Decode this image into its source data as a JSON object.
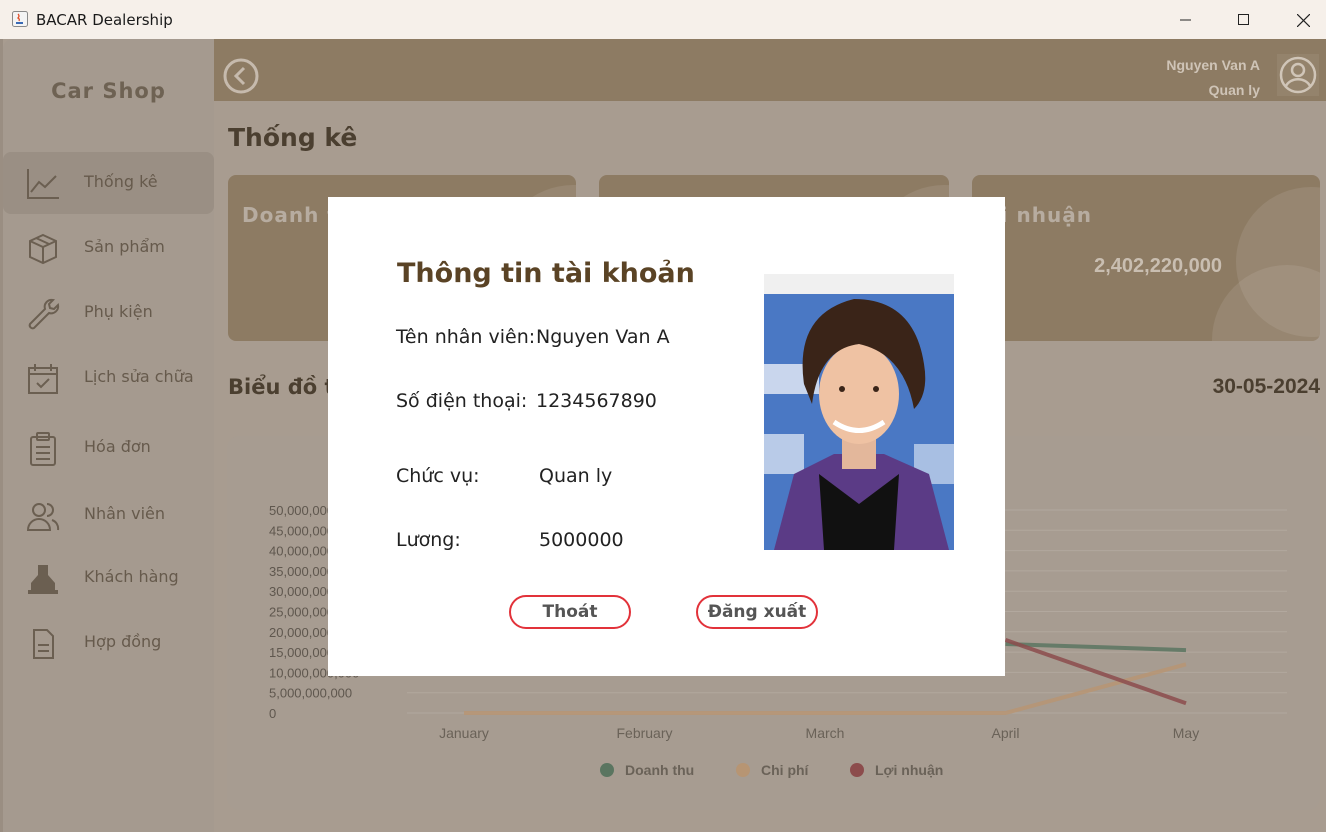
{
  "window": {
    "title": "BACAR Dealership"
  },
  "sidebar": {
    "brand": "Car Shop",
    "items": [
      {
        "label": "Thống kê",
        "icon": "trend-chart-icon",
        "active": true
      },
      {
        "label": "Sản phẩm",
        "icon": "box-icon"
      },
      {
        "label": "Phụ kiện",
        "icon": "wrench-icon"
      },
      {
        "label": "Lịch sửa chữa",
        "icon": "calendar-check-icon"
      },
      {
        "label": "Hóa đơn",
        "icon": "clipboard-icon"
      },
      {
        "label": "Nhân viên",
        "icon": "users-icon"
      },
      {
        "label": "Khách hàng",
        "icon": "customer-icon"
      },
      {
        "label": "Hợp đồng",
        "icon": "document-icon"
      }
    ]
  },
  "header": {
    "user_name": "Nguyen Van A",
    "user_role": "Quan ly"
  },
  "page": {
    "title": "Thống kê",
    "cards": [
      {
        "label": "Doanh t",
        "value": ""
      },
      {
        "label": "",
        "value": ""
      },
      {
        "label": "ợi nhuận",
        "value": "2,402,220,000"
      }
    ],
    "chart_title": "Biểu đồ t",
    "date": "30-05-2024"
  },
  "chart_data": {
    "type": "line",
    "categories": [
      "January",
      "February",
      "March",
      "April",
      "May"
    ],
    "y_ticks": [
      "0",
      "5,000,000,000",
      "10,000,000,000",
      "15,000,000,000",
      "20,000,000,000",
      "25,000,000,000",
      "30,000,000,000",
      "35,000,000,000",
      "40,000,000,000",
      "45,000,000,000",
      "50,000,000,000"
    ],
    "ylim": [
      0,
      50000000000
    ],
    "series": [
      {
        "name": "Doanh thu",
        "color": "#5a7560",
        "values": [
          null,
          null,
          null,
          17000000000,
          15500000000
        ]
      },
      {
        "name": "Chi phí",
        "color": "#b79573",
        "values": [
          0,
          0,
          0,
          0,
          12000000000
        ]
      },
      {
        "name": "Lợi nhuận",
        "color": "#8c4c4c",
        "values": [
          null,
          null,
          null,
          18000000000,
          2400000000
        ]
      }
    ],
    "legend_position": "bottom"
  },
  "modal": {
    "title": "Thông tin tài khoản",
    "fields": [
      {
        "label": "Tên nhân viên:",
        "value": "Nguyen Van A"
      },
      {
        "label": "Số điện thoại:",
        "value": "1234567890"
      },
      {
        "label": "Chức vụ:",
        "value": "Quan ly"
      },
      {
        "label": "Lương:",
        "value": "5000000"
      }
    ],
    "exit_label": "Thoát",
    "logout_label": "Đăng xuất"
  }
}
